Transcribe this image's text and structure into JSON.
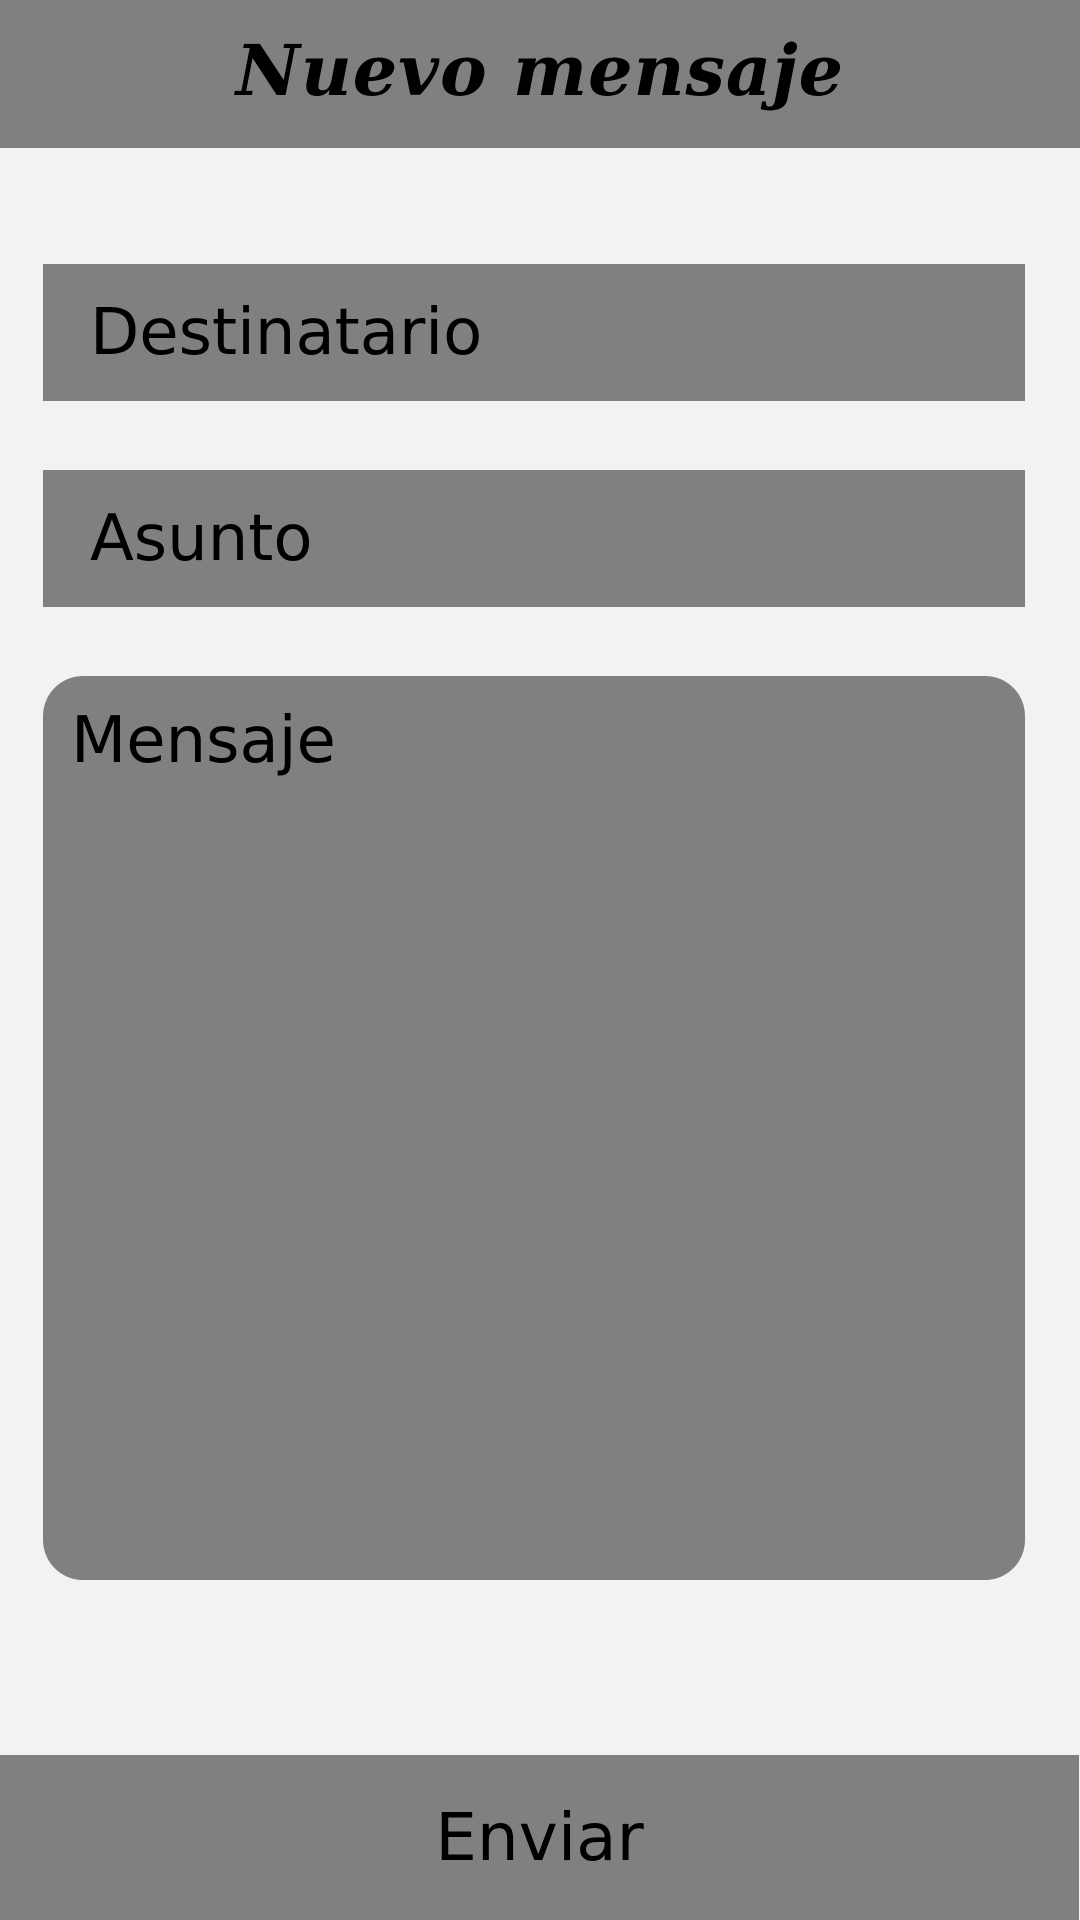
{
  "header": {
    "title": "Nuevo mensaje"
  },
  "form": {
    "recipient_placeholder": "Destinatario",
    "subject_placeholder": "Asunto",
    "message_placeholder": "Mensaje"
  },
  "actions": {
    "send_label": "Enviar"
  },
  "colors": {
    "background": "#f2f2f2",
    "surface": "#808080",
    "text": "#000000"
  }
}
